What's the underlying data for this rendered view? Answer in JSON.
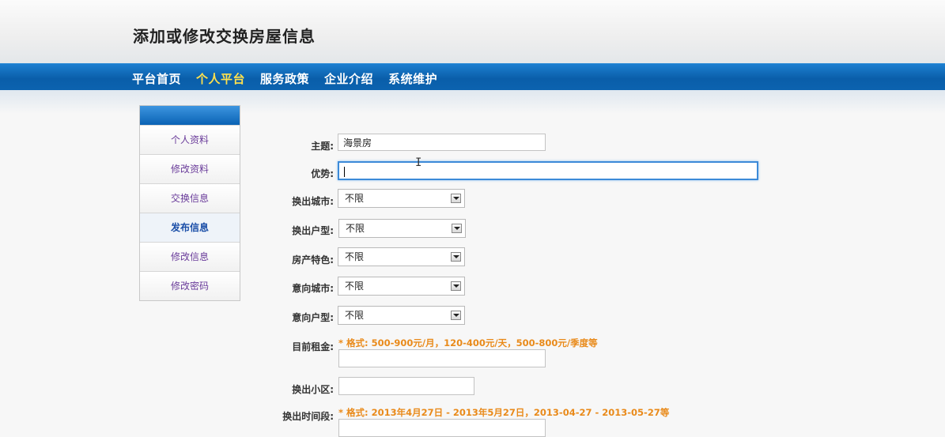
{
  "header": {
    "title": "添加或修改交换房屋信息"
  },
  "nav": {
    "items": [
      "平台首页",
      "个人平台",
      "服务政策",
      "企业介绍",
      "系统维护"
    ],
    "active_index": 1
  },
  "sidebar": {
    "items": [
      "个人资料",
      "修改资料",
      "交换信息",
      "发布信息",
      "修改信息",
      "修改密码"
    ],
    "active_index": 3
  },
  "form": {
    "subject": {
      "label": "主题:",
      "value": "海景房"
    },
    "advantage": {
      "label": "优势:",
      "value": ""
    },
    "out_city": {
      "label": "换出城市:",
      "value": "不限"
    },
    "out_layout": {
      "label": "换出户型:",
      "value": "不限"
    },
    "feature": {
      "label": "房产特色:",
      "value": "不限"
    },
    "target_city": {
      "label": "意向城市:",
      "value": "不限"
    },
    "target_layout": {
      "label": "意向户型:",
      "value": "不限"
    },
    "rent": {
      "label": "目前租金:",
      "hint": "* 格式: 500-900元/月，120-400元/天，500-800元/季度等",
      "value": ""
    },
    "community": {
      "label": "换出小区:",
      "value": ""
    },
    "period": {
      "label": "换出时间段:",
      "hint": "* 格式:  2013年4月27日 - 2013年5月27日，2013-04-27 - 2013-05-27等",
      "value": ""
    }
  },
  "colors": {
    "nav_bg": "#0a5ea9",
    "nav_active": "#ffe14d",
    "hint": "#e98a1a",
    "focus_border": "#3c8ad8"
  }
}
